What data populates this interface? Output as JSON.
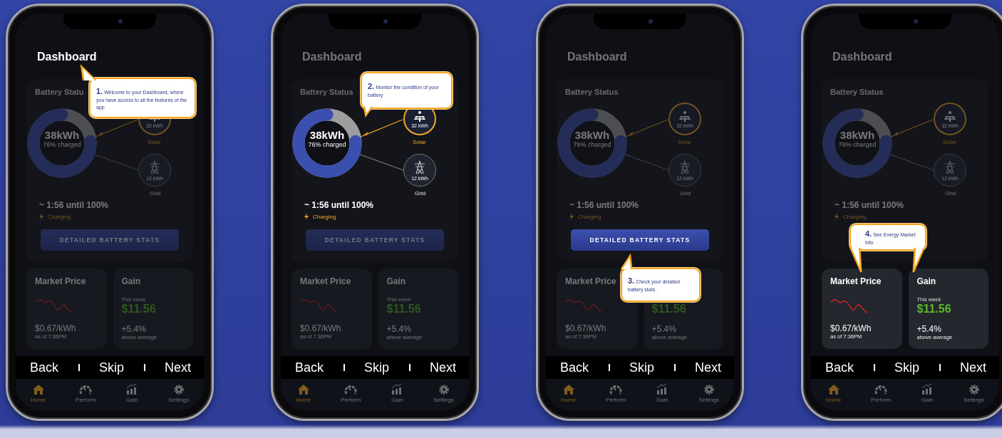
{
  "phones": [
    {
      "kind": "title",
      "tooltip": "**1.** Welcome to your Dashboard, where you have access to all the features of the app",
      "title": "Dashboard",
      "battery": {
        "title": "Battery Statu",
        "value": "38kWh",
        "charged": "76% charged",
        "level": 0.76,
        "solar": {
          "value": "32 kWh",
          "label": "Solar"
        },
        "grid": {
          "value": "12 kWh",
          "label": "Grid"
        },
        "time": "~ 1:56 until 100%",
        "status": "Charging",
        "button": "DETAILED BATTERY STATS"
      },
      "market": {
        "title": "Market Price",
        "price": "$0.67/kWh",
        "time": "as of 7:36PM"
      },
      "gain": {
        "title": "Gain",
        "period": "This week",
        "amount": "$11.56",
        "change": "+5.4%",
        "note": "above average"
      },
      "nav": {
        "back": "Back",
        "skip": "Skip",
        "next": "Next"
      },
      "tabs": [
        {
          "label": "Home",
          "selected": true
        },
        {
          "label": "Perform",
          "selected": false
        },
        {
          "label": "Gain",
          "selected": false
        },
        {
          "label": "Settings",
          "selected": false
        }
      ]
    },
    {
      "kind": "battery",
      "tooltip": "**2.** Monitor the condition of your battery",
      "title": "Dashboard",
      "battery": {
        "title": "Battery Status",
        "value": "38kWh",
        "charged": "76% charged",
        "level": 0.76,
        "solar": {
          "value": "32 kWh",
          "label": "Solar"
        },
        "grid": {
          "value": "12 kWh",
          "label": "Grid"
        },
        "time": "~ 1:56 until 100%",
        "status": "Charging",
        "button": "DETAILED BATTERY STATS"
      },
      "market": {
        "title": "Market Price",
        "price": "$0.67/kWh",
        "time": "as of 7:36PM"
      },
      "gain": {
        "title": "Gain",
        "period": "This week",
        "amount": "$11.56",
        "change": "+5.4%",
        "note": "above average"
      },
      "nav": {
        "back": "Back",
        "skip": "Skip",
        "next": "Next"
      },
      "tabs": [
        {
          "label": "Home",
          "selected": true
        },
        {
          "label": "Perform",
          "selected": false
        },
        {
          "label": "Gain",
          "selected": false
        },
        {
          "label": "Settings",
          "selected": false
        }
      ]
    },
    {
      "kind": "button",
      "tooltip": "**3.** Check your detailed battery stats.",
      "title": "Dashboard",
      "battery": {
        "title": "Battery Status",
        "value": "38kWh",
        "charged": "76% charged",
        "level": 0.76,
        "solar": {
          "value": "32 kWh",
          "label": "Solar"
        },
        "grid": {
          "value": "12 kWh",
          "label": "Grid"
        },
        "time": "~ 1:56 until 100%",
        "status": "Charging",
        "button": "DETAILED BATTERY STATS"
      },
      "market": {
        "title": "Market Price",
        "price": "$0.67/kWh",
        "time": "as of 7:36PM"
      },
      "gain": {
        "amount": "$11.56",
        "change": "+5.4%",
        "note": "above average"
      },
      "nav": {
        "back": "Back",
        "skip": "Skip",
        "next": "Next"
      },
      "tabs": [
        {
          "label": "Home",
          "selected": true
        },
        {
          "label": "Perform",
          "selected": false
        },
        {
          "label": "Gain",
          "selected": false
        },
        {
          "label": "Settings",
          "selected": false
        }
      ]
    },
    {
      "kind": "market",
      "tooltip": "**4.** See Evergy Market Info",
      "title": "Dashboard",
      "battery": {
        "title": "Battery Status",
        "value": "38kWh",
        "charged": "76% charged",
        "level": 0.76,
        "solar": {
          "value": "32 kWh",
          "label": "Solar"
        },
        "grid": {
          "value": "12 kWh",
          "label": "Grid"
        },
        "time": "~ 1:56 until 100%",
        "status": "Charging"
      },
      "market": {
        "title": "Market Price",
        "price": "$0.67/kWh",
        "time": "as of 7:36PM"
      },
      "gain": {
        "title": "Gain",
        "period": "This week",
        "amount": "$11.56",
        "change": "+5.4%",
        "note": "above average"
      },
      "nav": {
        "back": "Back",
        "skip": "Skip",
        "next": "Next"
      },
      "tabs": [
        {
          "label": "Home",
          "selected": true
        },
        {
          "label": "Perform",
          "selected": false
        },
        {
          "label": "Gain",
          "selected": false
        },
        {
          "label": "Settings",
          "selected": false
        }
      ]
    }
  ]
}
